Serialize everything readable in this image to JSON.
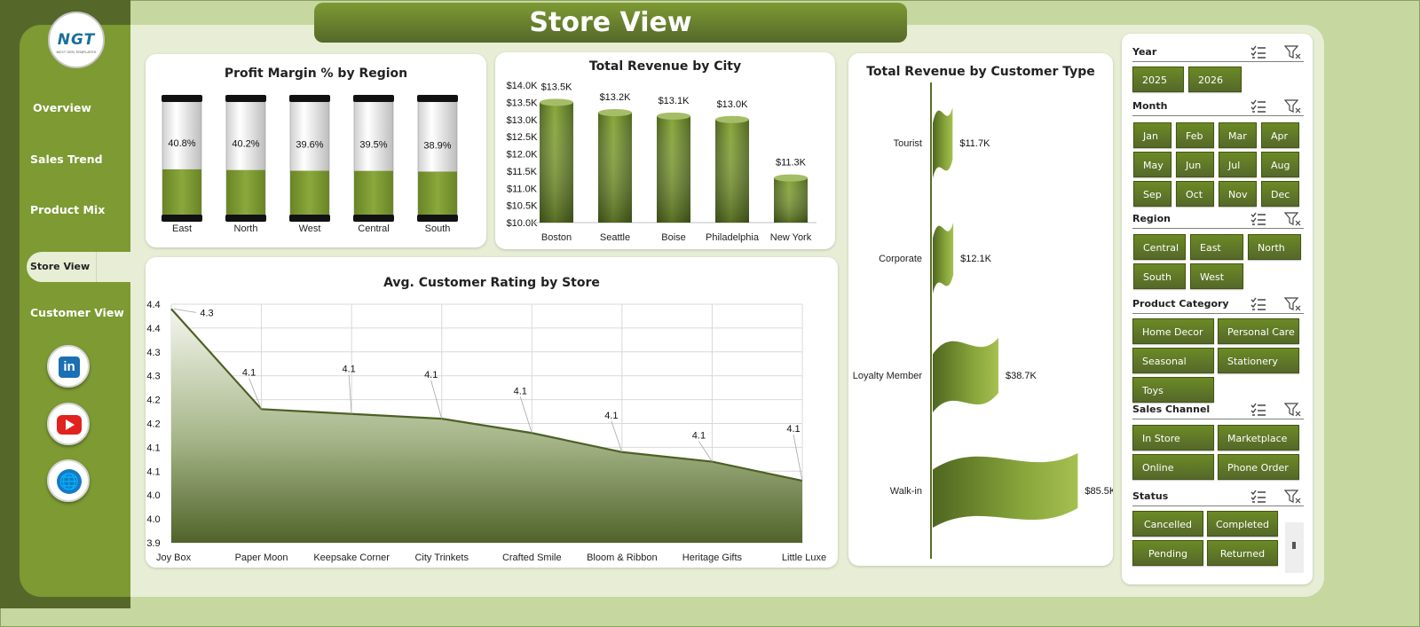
{
  "header": {
    "title": "Store View"
  },
  "logo": {
    "text": "NGT",
    "subtext": "NEXT GEN TEMPLATES"
  },
  "nav": {
    "items": [
      "Overview",
      "Sales Trend",
      "Product Mix",
      "Store View",
      "Customer View"
    ],
    "active": "Store View"
  },
  "social": [
    "linkedin-icon",
    "youtube-icon",
    "globe-icon"
  ],
  "colors": {
    "primary": "#7d9a33",
    "dark": "#55682a",
    "background": "#c6d7a0",
    "panel": "#e7eed5",
    "line": "#4d6124"
  },
  "charts": {
    "profit_margin": {
      "type": "bar",
      "title": "Profit Margin % by Region",
      "categories": [
        "East",
        "North",
        "West",
        "Central",
        "South"
      ],
      "values": [
        40.8,
        40.2,
        39.6,
        39.5,
        38.9
      ],
      "labels": [
        "40.8%",
        "40.2%",
        "39.6%",
        "39.5%",
        "38.9%"
      ]
    },
    "revenue_city": {
      "type": "bar",
      "title": "Total Revenue  by City",
      "categories": [
        "Boston",
        "Seattle",
        "Boise",
        "Philadelphia",
        "New York"
      ],
      "values": [
        13.5,
        13.2,
        13.1,
        13.0,
        11.3
      ],
      "labels": [
        "$13.5K",
        "$13.2K",
        "$13.1K",
        "$13.0K",
        "$11.3K"
      ],
      "y_ticks": [
        "$14.0K",
        "$13.5K",
        "$13.0K",
        "$12.5K",
        "$12.0K",
        "$11.5K",
        "$11.0K",
        "$10.5K",
        "$10.0K"
      ],
      "ylim": [
        10.0,
        14.0
      ]
    },
    "revenue_customer": {
      "type": "bar",
      "title": "Total Revenue  by Customer Type",
      "categories": [
        "Tourist",
        "Corporate",
        "Loyalty Member",
        "Walk-in"
      ],
      "values": [
        11.7,
        12.1,
        38.7,
        85.5
      ],
      "labels": [
        "$11.7K",
        "$12.1K",
        "$38.7K",
        "$85.5K"
      ]
    },
    "rating": {
      "type": "area",
      "title": "Avg. Customer Rating by Store",
      "categories": [
        "Joy Box",
        "Paper Moon",
        "Keepsake Corner",
        "City Trinkets",
        "Crafted Smile",
        "Bloom & Ribbon",
        "Heritage Gifts",
        "Little Luxe"
      ],
      "values": [
        4.39,
        4.18,
        4.17,
        4.16,
        4.13,
        4.09,
        4.07,
        4.03
      ],
      "labels": [
        "4.3",
        "4.1",
        "4.1",
        "4.1",
        "4.1",
        "4.1",
        "4.1",
        "4.1"
      ],
      "y_ticks": [
        "4.4",
        "4.4",
        "4.3",
        "4.3",
        "4.2",
        "4.2",
        "4.1",
        "4.1",
        "4.0",
        "4.0",
        "3.9"
      ],
      "ylim": [
        3.9,
        4.4
      ]
    }
  },
  "slicers": [
    {
      "label": "Year",
      "items": [
        "2025",
        "2026"
      ]
    },
    {
      "label": "Month",
      "items": [
        "Jan",
        "Feb",
        "Mar",
        "Apr",
        "May",
        "Jun",
        "Jul",
        "Aug",
        "Sep",
        "Oct",
        "Nov",
        "Dec"
      ]
    },
    {
      "label": "Region",
      "items": [
        "Central",
        "East",
        "North",
        "South",
        "West"
      ]
    },
    {
      "label": "Product Category",
      "items": [
        "Home Decor",
        "Personal Care",
        "Seasonal",
        "Stationery",
        "Toys"
      ]
    },
    {
      "label": "Sales Channel",
      "items": [
        "In Store",
        "Marketplace",
        "Online",
        "Phone Order"
      ]
    },
    {
      "label": "Status",
      "items": [
        "Cancelled",
        "Completed",
        "Pending",
        "Returned"
      ]
    }
  ]
}
